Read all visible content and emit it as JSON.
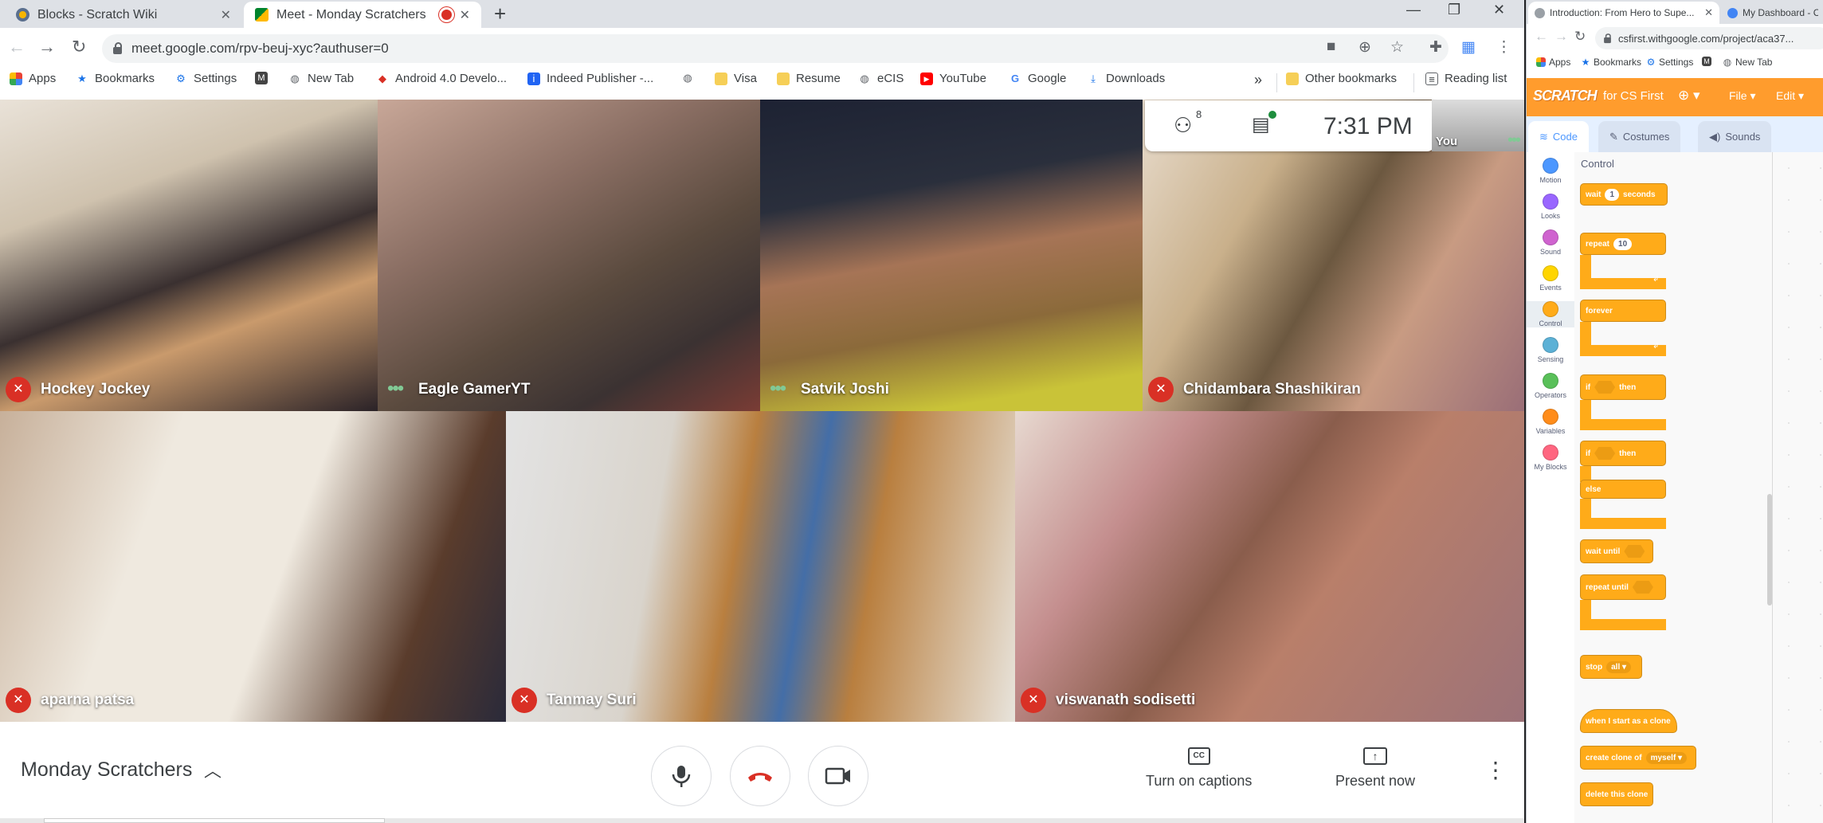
{
  "left_window": {
    "tabs": [
      {
        "title": "Blocks - Scratch Wiki",
        "active": false
      },
      {
        "title": "Meet - Monday Scratchers",
        "active": true
      }
    ],
    "url": "meet.google.com/rpv-beuj-xyc?authuser=0",
    "bookmarks": [
      "Apps",
      "Bookmarks",
      "Settings",
      "New Tab",
      "Android 4.0 Develo...",
      "Indeed Publisher -...",
      "Visa",
      "Resume",
      "eCIS",
      "YouTube",
      "Google",
      "Downloads"
    ],
    "bookmarks_more": "»",
    "other_bookmarks": "Other bookmarks",
    "reading_list": "Reading list"
  },
  "meet": {
    "participant_count": "8",
    "clock": "7:31 PM",
    "self_label": "You",
    "participants": [
      {
        "name": "Hockey Jockey",
        "status": "muted"
      },
      {
        "name": "Eagle GamerYT",
        "status": "more"
      },
      {
        "name": "Satvik Joshi",
        "status": "more"
      },
      {
        "name": "Chidambara Shashikiran",
        "status": "muted"
      },
      {
        "name": "aparna patsa",
        "status": "muted"
      },
      {
        "name": "Tanmay Suri",
        "status": "muted"
      },
      {
        "name": "viswanath sodisetti",
        "status": "muted"
      }
    ],
    "meeting_name": "Monday Scratchers",
    "captions_label": "Turn on captions",
    "present_label": "Present now"
  },
  "right_window": {
    "tabs": [
      {
        "title": "Introduction: From Hero to Supe..."
      },
      {
        "title": "My Dashboard - C..."
      }
    ],
    "url": "csfirst.withgoogle.com/project/aca37...",
    "bookmarks": [
      "Apps",
      "Bookmarks",
      "Settings",
      "New Tab"
    ]
  },
  "scratch": {
    "logo": "SCRATCH",
    "for_cs_first": "for CS First",
    "menu_file": "File",
    "menu_edit": "Edit",
    "tabs": {
      "code": "Code",
      "costumes": "Costumes",
      "sounds": "Sounds"
    },
    "categories": [
      {
        "label": "Motion",
        "color": "#4c97ff"
      },
      {
        "label": "Looks",
        "color": "#9966ff"
      },
      {
        "label": "Sound",
        "color": "#cf63cf"
      },
      {
        "label": "Events",
        "color": "#ffd500"
      },
      {
        "label": "Control",
        "color": "#ffab19"
      },
      {
        "label": "Sensing",
        "color": "#5cb1d6"
      },
      {
        "label": "Operators",
        "color": "#59c059"
      },
      {
        "label": "Variables",
        "color": "#ff8c1a"
      },
      {
        "label": "My Blocks",
        "color": "#ff6680"
      }
    ],
    "palette_title": "Control",
    "blocks": {
      "wait": "wait",
      "wait_value": "1",
      "seconds": "seconds",
      "repeat": "repeat",
      "repeat_value": "10",
      "forever": "forever",
      "if": "if",
      "then": "then",
      "else": "else",
      "wait_until": "wait until",
      "repeat_until": "repeat until",
      "stop": "stop",
      "stop_option": "all",
      "when_clone": "when I start as a clone",
      "create_clone": "create clone of",
      "clone_option": "myself",
      "delete_clone": "delete this clone"
    }
  }
}
